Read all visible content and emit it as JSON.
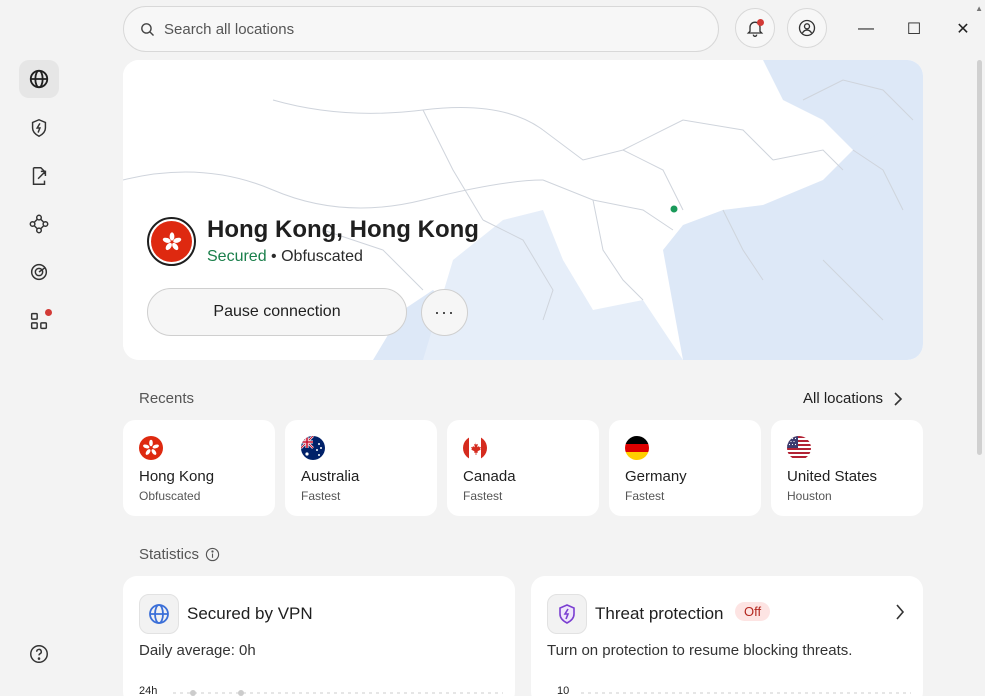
{
  "search": {
    "placeholder": "Search all locations"
  },
  "window": {
    "minimize": "—",
    "maximize": "☐",
    "close": "✕"
  },
  "connection": {
    "location": "Hong Kong, Hong Kong",
    "status_secured": "Secured",
    "status_separator": " • ",
    "status_mode": "Obfuscated",
    "pause_label": "Pause connection",
    "more_label": "···"
  },
  "recents": {
    "label": "Recents",
    "all_locations": "All locations",
    "items": [
      {
        "name": "Hong Kong",
        "sub": "Obfuscated",
        "flag": "hk-flag-icon"
      },
      {
        "name": "Australia",
        "sub": "Fastest",
        "flag": "au-flag-icon"
      },
      {
        "name": "Canada",
        "sub": "Fastest",
        "flag": "ca-flag-icon"
      },
      {
        "name": "Germany",
        "sub": "Fastest",
        "flag": "de-flag-icon"
      },
      {
        "name": "United States",
        "sub": "Houston",
        "flag": "us-flag-icon"
      }
    ]
  },
  "statistics": {
    "label": "Statistics",
    "vpn": {
      "title": "Secured by VPN",
      "sub": "Daily average: 0h",
      "axis_top": "24h"
    },
    "threat": {
      "title": "Threat protection",
      "badge": "Off",
      "sub": "Turn on protection to resume blocking threats.",
      "axis_top": "10"
    }
  },
  "colors": {
    "accent_green": "#1a7f4b",
    "map_water": "#dde8f7",
    "red_dot": "#d23a36"
  }
}
